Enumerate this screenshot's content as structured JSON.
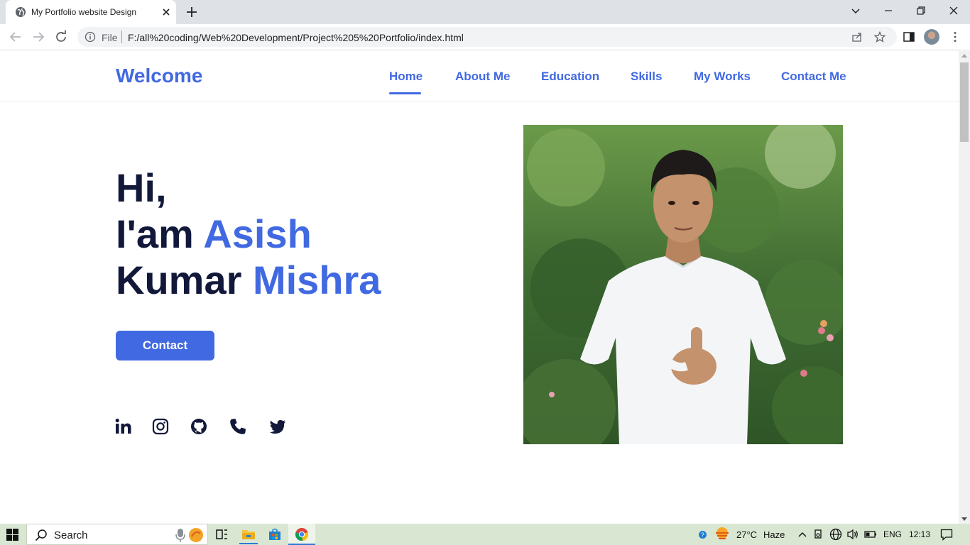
{
  "browser": {
    "tab_title": "My Portfolio website Design",
    "scheme_label": "File",
    "url": "F:/all%20coding/Web%20Development/Project%205%20Portfolio/index.html"
  },
  "site": {
    "brand": "Welcome",
    "nav": [
      "Home",
      "About Me",
      "Education",
      "Skills",
      "My Works",
      "Contact Me"
    ],
    "active_nav": "Home",
    "hero": {
      "line1": "Hi,",
      "line2_plain": "I'am ",
      "line2_accent": "Asish",
      "line3_plain": "Kumar ",
      "line3_accent": "Mishra"
    },
    "contact_button": "Contact",
    "social_icons": [
      "linkedin-icon",
      "instagram-icon",
      "github-icon",
      "phone-icon",
      "twitter-icon"
    ],
    "colors": {
      "accent": "#4169e1",
      "heading": "#12183a"
    }
  },
  "taskbar": {
    "search_label": "Search",
    "temperature": "27°C",
    "weather": "Haze",
    "language": "ENG",
    "time": "12:13"
  }
}
